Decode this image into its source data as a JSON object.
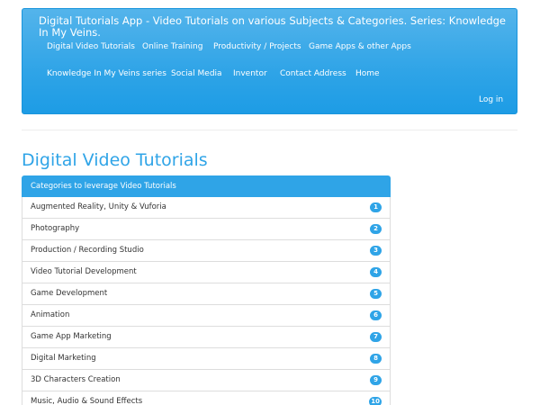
{
  "navbar": {
    "brand": "Digital Tutorials App - Video Tutorials on various Subjects & Categories. Series: Knowledge In My Veins.",
    "links": [
      {
        "label": "Digital Video Tutorials"
      },
      {
        "label": "Online Training"
      },
      {
        "label": "Productivity / Projects"
      },
      {
        "label": "Game Apps & other Apps"
      },
      {
        "label": "Knowledge In My Veins series"
      },
      {
        "label": "Social Media"
      },
      {
        "label": "Inventor"
      },
      {
        "label": "Contact Address"
      },
      {
        "label": "Home"
      }
    ],
    "login": "Log in"
  },
  "main": {
    "title": "Digital Video Tutorials",
    "list_header": "Categories to leverage Video Tutorials",
    "categories": [
      {
        "label": "Augmented Reality, Unity & Vuforia",
        "badge": "1"
      },
      {
        "label": "Photography",
        "badge": "2"
      },
      {
        "label": "Production / Recording Studio",
        "badge": "3"
      },
      {
        "label": "Video Tutorial Development",
        "badge": "4"
      },
      {
        "label": "Game Development",
        "badge": "5"
      },
      {
        "label": "Animation",
        "badge": "6"
      },
      {
        "label": "Game App Marketing",
        "badge": "7"
      },
      {
        "label": "Digital Marketing",
        "badge": "8"
      },
      {
        "label": "3D Characters Creation",
        "badge": "9"
      },
      {
        "label": "Music, Audio & Sound Effects",
        "badge": "10"
      }
    ]
  },
  "colors": {
    "accent": "#2fa4e7",
    "navbar_gradient_top": "#54b4eb",
    "navbar_gradient_bottom": "#1d9ce5",
    "text": "#333333",
    "border": "#dddddd"
  }
}
